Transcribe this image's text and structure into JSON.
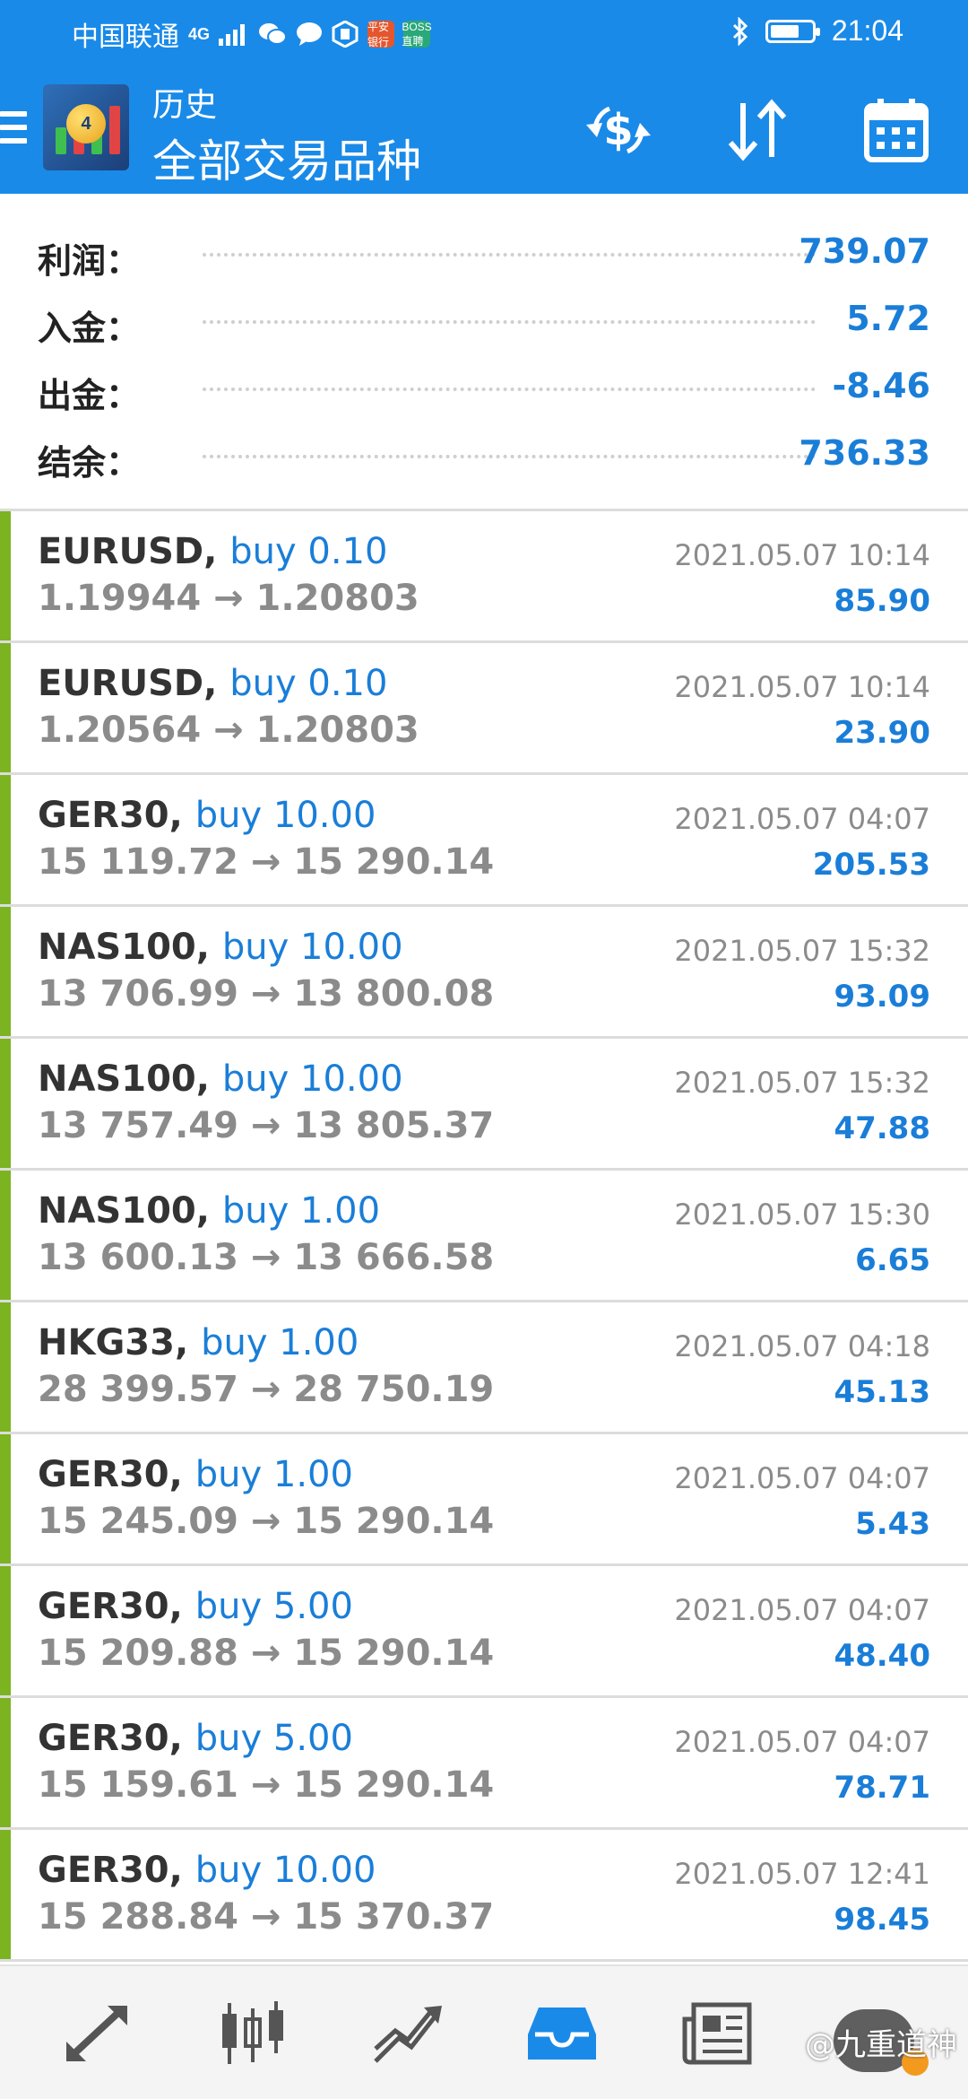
{
  "status_bar": {
    "carrier": "中国联通",
    "network": "4G",
    "time": "21:04",
    "battery_level": 0.7,
    "icons": [
      "signal-icon",
      "wechat-icon",
      "message-icon",
      "app-icon",
      "bank-app-icon",
      "boss-app-icon",
      "bluetooth-icon",
      "battery-icon"
    ],
    "bank_app_text": "平安银行",
    "boss_app_text": "BOSS直聘"
  },
  "app_bar": {
    "title_small": "历史",
    "title_big": "全部交易品种",
    "actions": [
      "currency-exchange-icon",
      "sort-icon",
      "calendar-icon"
    ],
    "accent_color": "#1a8ae8"
  },
  "summary": [
    {
      "label": "利润：",
      "value": "739.07"
    },
    {
      "label": "入金：",
      "value": "5.72"
    },
    {
      "label": "出金：",
      "value": "-8.46"
    },
    {
      "label": "结余：",
      "value": "736.33"
    }
  ],
  "trades": [
    {
      "symbol": "EURUSD,",
      "type": "buy 0.10",
      "prices": "1.19944 → 1.20803",
      "time": "2021.05.07 10:14",
      "profit": "85.90"
    },
    {
      "symbol": "EURUSD,",
      "type": "buy 0.10",
      "prices": "1.20564 → 1.20803",
      "time": "2021.05.07 10:14",
      "profit": "23.90"
    },
    {
      "symbol": "GER30,",
      "type": "buy 10.00",
      "prices": "15 119.72 → 15 290.14",
      "time": "2021.05.07 04:07",
      "profit": "205.53"
    },
    {
      "symbol": "NAS100,",
      "type": "buy 10.00",
      "prices": "13 706.99 → 13 800.08",
      "time": "2021.05.07 15:32",
      "profit": "93.09"
    },
    {
      "symbol": "NAS100,",
      "type": "buy 10.00",
      "prices": "13 757.49 → 13 805.37",
      "time": "2021.05.07 15:32",
      "profit": "47.88"
    },
    {
      "symbol": "NAS100,",
      "type": "buy 1.00",
      "prices": "13 600.13 → 13 666.58",
      "time": "2021.05.07 15:30",
      "profit": "6.65"
    },
    {
      "symbol": "HKG33,",
      "type": "buy 1.00",
      "prices": "28 399.57 → 28 750.19",
      "time": "2021.05.07 04:18",
      "profit": "45.13"
    },
    {
      "symbol": "GER30,",
      "type": "buy 1.00",
      "prices": "15 245.09 → 15 290.14",
      "time": "2021.05.07 04:07",
      "profit": "5.43"
    },
    {
      "symbol": "GER30,",
      "type": "buy 5.00",
      "prices": "15 209.88 → 15 290.14",
      "time": "2021.05.07 04:07",
      "profit": "48.40"
    },
    {
      "symbol": "GER30,",
      "type": "buy 5.00",
      "prices": "15 159.61 → 15 290.14",
      "time": "2021.05.07 04:07",
      "profit": "78.71"
    },
    {
      "symbol": "GER30,",
      "type": "buy 10.00",
      "prices": "15 288.84 → 15 370.37",
      "time": "2021.05.07 12:41",
      "profit": "98.45"
    }
  ],
  "colors": {
    "buy_accent": "#7bb321",
    "value_blue": "#1a7ed8",
    "muted_gray": "#8b8b8b"
  },
  "bottom_nav": {
    "items": [
      "quotes-icon",
      "chart-candles-icon",
      "trade-icon",
      "history-icon",
      "news-icon",
      "chat-icon"
    ],
    "active": "history-icon",
    "watermark": "@九重道神"
  }
}
